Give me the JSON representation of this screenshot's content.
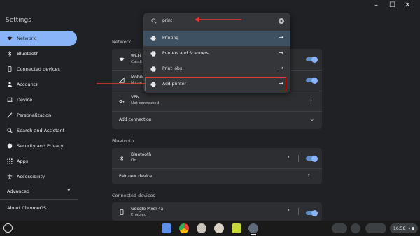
{
  "window": {
    "title": "Settings"
  },
  "sidebar": {
    "items": [
      {
        "label": "Network",
        "icon": "wifi-icon",
        "active": true
      },
      {
        "label": "Bluetooth",
        "icon": "bluetooth-icon"
      },
      {
        "label": "Connected devices",
        "icon": "phone-icon"
      },
      {
        "label": "Accounts",
        "icon": "person-icon"
      },
      {
        "label": "Device",
        "icon": "laptop-icon"
      },
      {
        "label": "Personalization",
        "icon": "brush-icon"
      },
      {
        "label": "Search and Assistant",
        "icon": "search-icon"
      },
      {
        "label": "Security and Privacy",
        "icon": "shield-icon"
      },
      {
        "label": "Apps",
        "icon": "apps-grid-icon"
      },
      {
        "label": "Accessibility",
        "icon": "accessibility-icon"
      }
    ],
    "advanced_label": "Advanced",
    "about_label": "About ChromeOS"
  },
  "network": {
    "heading": "Network",
    "wifi_label": "Wi-Fi",
    "wifi_sub": "Candi",
    "mobile_label": "Mobile",
    "mobile_sub": "No ne",
    "vpn_label": "VPN",
    "vpn_sub": "Not connected",
    "add_connection": "Add connection"
  },
  "bluetooth": {
    "heading": "Bluetooth",
    "label": "Bluetooth",
    "sub": "On",
    "pair": "Pair new device"
  },
  "connected": {
    "heading": "Connected devices",
    "label": "Google Pixel 4a",
    "sub": "Enabled"
  },
  "search": {
    "query": "print",
    "results": [
      {
        "label": "Printing",
        "selected": true
      },
      {
        "label": "Printers and Scanners"
      },
      {
        "label": "Print jobs"
      },
      {
        "label": "Add printer",
        "highlighted": true
      }
    ]
  },
  "shelf": {
    "time": "16:58"
  },
  "colors": {
    "accent": "#8ab4f8",
    "background": "#202124",
    "card": "#2d2e31",
    "annotation": "#e53935"
  }
}
